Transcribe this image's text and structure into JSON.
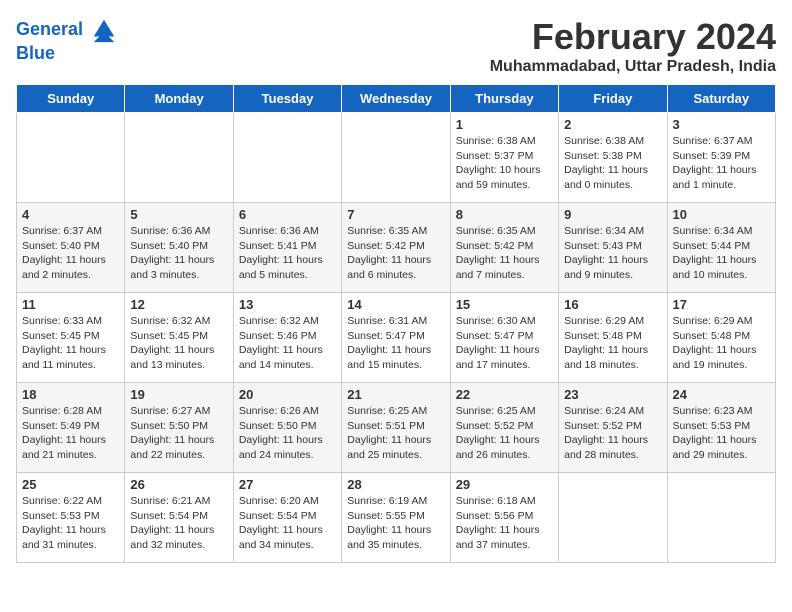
{
  "logo": {
    "line1": "General",
    "line2": "Blue"
  },
  "title": "February 2024",
  "location": "Muhammadabad, Uttar Pradesh, India",
  "days_header": [
    "Sunday",
    "Monday",
    "Tuesday",
    "Wednesday",
    "Thursday",
    "Friday",
    "Saturday"
  ],
  "weeks": [
    [
      {
        "day": "",
        "info": ""
      },
      {
        "day": "",
        "info": ""
      },
      {
        "day": "",
        "info": ""
      },
      {
        "day": "",
        "info": ""
      },
      {
        "day": "1",
        "info": "Sunrise: 6:38 AM\nSunset: 5:37 PM\nDaylight: 10 hours and 59 minutes."
      },
      {
        "day": "2",
        "info": "Sunrise: 6:38 AM\nSunset: 5:38 PM\nDaylight: 11 hours and 0 minutes."
      },
      {
        "day": "3",
        "info": "Sunrise: 6:37 AM\nSunset: 5:39 PM\nDaylight: 11 hours and 1 minute."
      }
    ],
    [
      {
        "day": "4",
        "info": "Sunrise: 6:37 AM\nSunset: 5:40 PM\nDaylight: 11 hours and 2 minutes."
      },
      {
        "day": "5",
        "info": "Sunrise: 6:36 AM\nSunset: 5:40 PM\nDaylight: 11 hours and 3 minutes."
      },
      {
        "day": "6",
        "info": "Sunrise: 6:36 AM\nSunset: 5:41 PM\nDaylight: 11 hours and 5 minutes."
      },
      {
        "day": "7",
        "info": "Sunrise: 6:35 AM\nSunset: 5:42 PM\nDaylight: 11 hours and 6 minutes."
      },
      {
        "day": "8",
        "info": "Sunrise: 6:35 AM\nSunset: 5:42 PM\nDaylight: 11 hours and 7 minutes."
      },
      {
        "day": "9",
        "info": "Sunrise: 6:34 AM\nSunset: 5:43 PM\nDaylight: 11 hours and 9 minutes."
      },
      {
        "day": "10",
        "info": "Sunrise: 6:34 AM\nSunset: 5:44 PM\nDaylight: 11 hours and 10 minutes."
      }
    ],
    [
      {
        "day": "11",
        "info": "Sunrise: 6:33 AM\nSunset: 5:45 PM\nDaylight: 11 hours and 11 minutes."
      },
      {
        "day": "12",
        "info": "Sunrise: 6:32 AM\nSunset: 5:45 PM\nDaylight: 11 hours and 13 minutes."
      },
      {
        "day": "13",
        "info": "Sunrise: 6:32 AM\nSunset: 5:46 PM\nDaylight: 11 hours and 14 minutes."
      },
      {
        "day": "14",
        "info": "Sunrise: 6:31 AM\nSunset: 5:47 PM\nDaylight: 11 hours and 15 minutes."
      },
      {
        "day": "15",
        "info": "Sunrise: 6:30 AM\nSunset: 5:47 PM\nDaylight: 11 hours and 17 minutes."
      },
      {
        "day": "16",
        "info": "Sunrise: 6:29 AM\nSunset: 5:48 PM\nDaylight: 11 hours and 18 minutes."
      },
      {
        "day": "17",
        "info": "Sunrise: 6:29 AM\nSunset: 5:48 PM\nDaylight: 11 hours and 19 minutes."
      }
    ],
    [
      {
        "day": "18",
        "info": "Sunrise: 6:28 AM\nSunset: 5:49 PM\nDaylight: 11 hours and 21 minutes."
      },
      {
        "day": "19",
        "info": "Sunrise: 6:27 AM\nSunset: 5:50 PM\nDaylight: 11 hours and 22 minutes."
      },
      {
        "day": "20",
        "info": "Sunrise: 6:26 AM\nSunset: 5:50 PM\nDaylight: 11 hours and 24 minutes."
      },
      {
        "day": "21",
        "info": "Sunrise: 6:25 AM\nSunset: 5:51 PM\nDaylight: 11 hours and 25 minutes."
      },
      {
        "day": "22",
        "info": "Sunrise: 6:25 AM\nSunset: 5:52 PM\nDaylight: 11 hours and 26 minutes."
      },
      {
        "day": "23",
        "info": "Sunrise: 6:24 AM\nSunset: 5:52 PM\nDaylight: 11 hours and 28 minutes."
      },
      {
        "day": "24",
        "info": "Sunrise: 6:23 AM\nSunset: 5:53 PM\nDaylight: 11 hours and 29 minutes."
      }
    ],
    [
      {
        "day": "25",
        "info": "Sunrise: 6:22 AM\nSunset: 5:53 PM\nDaylight: 11 hours and 31 minutes."
      },
      {
        "day": "26",
        "info": "Sunrise: 6:21 AM\nSunset: 5:54 PM\nDaylight: 11 hours and 32 minutes."
      },
      {
        "day": "27",
        "info": "Sunrise: 6:20 AM\nSunset: 5:54 PM\nDaylight: 11 hours and 34 minutes."
      },
      {
        "day": "28",
        "info": "Sunrise: 6:19 AM\nSunset: 5:55 PM\nDaylight: 11 hours and 35 minutes."
      },
      {
        "day": "29",
        "info": "Sunrise: 6:18 AM\nSunset: 5:56 PM\nDaylight: 11 hours and 37 minutes."
      },
      {
        "day": "",
        "info": ""
      },
      {
        "day": "",
        "info": ""
      }
    ]
  ]
}
